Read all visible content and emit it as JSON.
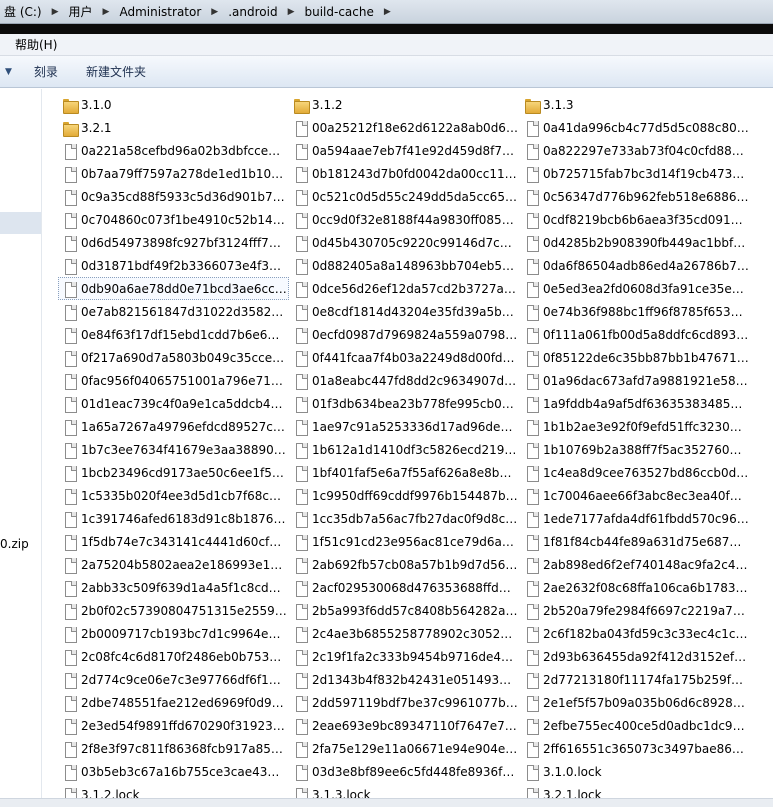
{
  "breadcrumb": [
    "盘 (C:)",
    "用户",
    "Administrator",
    ".android",
    "build-cache"
  ],
  "menu": {
    "help_label": "帮助(H)"
  },
  "toolbar": {
    "burn_label": "刻录",
    "new_folder_label": "新建文件夹"
  },
  "navpane": {
    "partial_item": "0.zip"
  },
  "items": [
    {
      "name": "3.1.0",
      "type": "folder"
    },
    {
      "name": "3.1.2",
      "type": "folder"
    },
    {
      "name": "3.1.3",
      "type": "folder"
    },
    {
      "name": "3.2.1",
      "type": "folder"
    },
    {
      "name": "00a25212f18e62d6122a8ab0d6f…",
      "type": "file"
    },
    {
      "name": "0a41da996cb4c77d5d5c088c80a…",
      "type": "file"
    },
    {
      "name": "0a221a58cefbd96a02b3dbfccebf…",
      "type": "file"
    },
    {
      "name": "0a594aae7eb7f41e92d459d8f76…",
      "type": "file"
    },
    {
      "name": "0a822297e733ab73f04c0cfd8832…",
      "type": "file"
    },
    {
      "name": "0b7aa79ff7597a278de1ed1b10bf…",
      "type": "file"
    },
    {
      "name": "0b181243d7b0fd0042da00cc111…",
      "type": "file"
    },
    {
      "name": "0b725715fab7bc3d14f19cb47325…",
      "type": "file"
    },
    {
      "name": "0c9a35cd88f5933c5d36d901b74…",
      "type": "file"
    },
    {
      "name": "0c521c0d5d55c249dd5da5cc65f6…",
      "type": "file"
    },
    {
      "name": "0c56347d776b962feb518e68860…",
      "type": "file"
    },
    {
      "name": "0c704860c073f1be4910c52b140b…",
      "type": "file"
    },
    {
      "name": "0cc9d0f32e8188f44a9830ff085b3…",
      "type": "file"
    },
    {
      "name": "0cdf8219bcb6b6aea3f35cd091ff0…",
      "type": "file"
    },
    {
      "name": "0d6d54973898fc927bf3124fff708…",
      "type": "file"
    },
    {
      "name": "0d45b430705c9220c99146d7ccd…",
      "type": "file"
    },
    {
      "name": "0d4285b2b908390fb449ac1bbfa…",
      "type": "file"
    },
    {
      "name": "0d31871bdf49f2b3366073e4f367…",
      "type": "file"
    },
    {
      "name": "0d882405a8a148963bb704eb556…",
      "type": "file"
    },
    {
      "name": "0da6f86504adb86ed4a26786b7b…",
      "type": "file"
    },
    {
      "name": "0db90a6ae78dd0e71bcd3ae6ccd…",
      "type": "file",
      "focused": true
    },
    {
      "name": "0dce56d26ef12da57cd2b3727aa…",
      "type": "file"
    },
    {
      "name": "0e5ed3ea2fd0608d3fa91ce35ed1…",
      "type": "file"
    },
    {
      "name": "0e7ab821561847d31022d3582e3…",
      "type": "file"
    },
    {
      "name": "0e8cdf1814d43204e35fd39a5b69…",
      "type": "file"
    },
    {
      "name": "0e74b36f988bc1ff96f8785f653e1…",
      "type": "file"
    },
    {
      "name": "0e84f63f17df15ebd1cdd7b6e64e…",
      "type": "file"
    },
    {
      "name": "0ecfd0987d7969824a559a07989…",
      "type": "file"
    },
    {
      "name": "0f111a061fb00d5a8ddfc6cd8939…",
      "type": "file"
    },
    {
      "name": "0f217a690d7a5803b049c35cce61…",
      "type": "file"
    },
    {
      "name": "0f441fcaa7f4b03a2249d8d00fdb…",
      "type": "file"
    },
    {
      "name": "0f85122de6c35bb87bb1b476716…",
      "type": "file"
    },
    {
      "name": "0fac956f04065751001a796e7185…",
      "type": "file"
    },
    {
      "name": "01a8eabc447fd8dd2c9634907dd…",
      "type": "file"
    },
    {
      "name": "01a96dac673afd7a9881921e580…",
      "type": "file"
    },
    {
      "name": "01d1eac739c4f0a9e1ca5ddcb486…",
      "type": "file"
    },
    {
      "name": "01f3db634bea23b778fe995cb06c…",
      "type": "file"
    },
    {
      "name": "1a9fddb4a9af5df6363538348529…",
      "type": "file"
    },
    {
      "name": "1a65a7267a49796efdcd89527ca…",
      "type": "file"
    },
    {
      "name": "1ae97c91a5253336d17ad96de17…",
      "type": "file"
    },
    {
      "name": "1b1b2ae3e92f0f9efd51ffc323005…",
      "type": "file"
    },
    {
      "name": "1b7c3ee7634f41679e3aa38890d…",
      "type": "file"
    },
    {
      "name": "1b612a1d1410df3c5826ecd2190…",
      "type": "file"
    },
    {
      "name": "1b10769b2a388ff7f5ac35276041…",
      "type": "file"
    },
    {
      "name": "1bcb23496cd9173ae50c6ee1f5c4…",
      "type": "file"
    },
    {
      "name": "1bf401faf5e6a7f55af626a8e8b2e…",
      "type": "file"
    },
    {
      "name": "1c4ea8d9cee763527bd86ccb0dc…",
      "type": "file"
    },
    {
      "name": "1c5335b020f4ee3d5d1cb7f68c73…",
      "type": "file"
    },
    {
      "name": "1c9950dff69cddf9976b154487be…",
      "type": "file"
    },
    {
      "name": "1c70046aee66f3abc8ec3ea40f69…",
      "type": "file"
    },
    {
      "name": "1c391746afed6183d91c8b18767f…",
      "type": "file"
    },
    {
      "name": "1cc35db7a56ac7fb27dac0f9d8cd…",
      "type": "file"
    },
    {
      "name": "1ede7177afda4df61fbdd570c962…",
      "type": "file"
    },
    {
      "name": "1f5db74e7c343141c4441d60cf26…",
      "type": "file"
    },
    {
      "name": "1f51c91cd23e956ac81ce79d6ade…",
      "type": "file"
    },
    {
      "name": "1f81f84cb44fe89a631d75e68745…",
      "type": "file"
    },
    {
      "name": "2a75204b5802aea2e186993e157…",
      "type": "file"
    },
    {
      "name": "2ab692fb57cb08a57b1b9d7d56e…",
      "type": "file"
    },
    {
      "name": "2ab898ed6f2ef740148ac9fa2c4d…",
      "type": "file"
    },
    {
      "name": "2abb33c509f639d1a4a5f1c8cd6c…",
      "type": "file"
    },
    {
      "name": "2acf029530068d476353688ffd43f…",
      "type": "file"
    },
    {
      "name": "2ae2632f08c68ffa106ca6b1783e0…",
      "type": "file"
    },
    {
      "name": "2b0f02c57390804751315e255938…",
      "type": "file"
    },
    {
      "name": "2b5a993f6dd57c8408b564282a7…",
      "type": "file"
    },
    {
      "name": "2b520a79fe2984f6697c2219a782…",
      "type": "file"
    },
    {
      "name": "2b0009717cb193bc7d1c9964e46…",
      "type": "file"
    },
    {
      "name": "2c4ae3b6855258778902c30527c…",
      "type": "file"
    },
    {
      "name": "2c6f182ba043fd59c3c33ec4c1caa…",
      "type": "file"
    },
    {
      "name": "2c08fc4c6d8170f2486eb0b75350…",
      "type": "file"
    },
    {
      "name": "2c19f1fa2c333b9454b9716de40f…",
      "type": "file"
    },
    {
      "name": "2d93b636455da92f412d3152ef1f…",
      "type": "file"
    },
    {
      "name": "2d774c9ce06e7c3e97766df6f19a…",
      "type": "file"
    },
    {
      "name": "2d1343b4f832b42431e0514930d…",
      "type": "file"
    },
    {
      "name": "2d77213180f11174fa175b259fe4…",
      "type": "file"
    },
    {
      "name": "2dbe748551fae212ed6969f0d9c3…",
      "type": "file"
    },
    {
      "name": "2dd597119bdf7be37c9961077bb…",
      "type": "file"
    },
    {
      "name": "2e1ef5f57b09a035b06d6c892811…",
      "type": "file"
    },
    {
      "name": "2e3ed54f9891ffd670290f31923cb…",
      "type": "file"
    },
    {
      "name": "2eae693e9bc89347110f7647e707…",
      "type": "file"
    },
    {
      "name": "2efbe755ec400ce5d0adbc1dc98…",
      "type": "file"
    },
    {
      "name": "2f8e3f97c811f86368fcb917a85c8…",
      "type": "file"
    },
    {
      "name": "2fa75e129e11a06671e94e904e6c…",
      "type": "file"
    },
    {
      "name": "2ff616551c365073c3497bae860b…",
      "type": "file"
    },
    {
      "name": "03b5eb3c67a16b755ce3cae4394…",
      "type": "file"
    },
    {
      "name": "03d3e8bf89ee6c5fd448fe8936fcc…",
      "type": "file"
    },
    {
      "name": "3.1.0.lock",
      "type": "file"
    },
    {
      "name": "3.1.2.lock",
      "type": "file"
    },
    {
      "name": "3.1.3.lock",
      "type": "file"
    },
    {
      "name": "3.2.1.lock",
      "type": "file"
    }
  ]
}
